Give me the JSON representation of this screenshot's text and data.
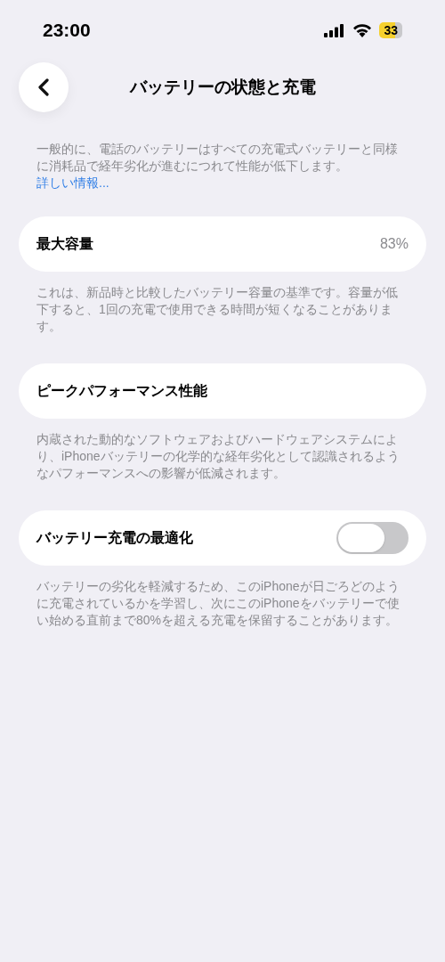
{
  "status_bar": {
    "time": "23:00",
    "battery": "33"
  },
  "header": {
    "title": "バッテリーの状態と充電"
  },
  "intro": {
    "text": "一般的に、電話のバッテリーはすべての充電式バッテリーと同様に消耗品で経年劣化が進むにつれて性能が低下します。",
    "link": "詳しい情報..."
  },
  "sections": [
    {
      "kind": "value",
      "label": "最大容量",
      "value": "83%",
      "footer": "これは、新品時と比較したバッテリー容量の基準です。容量が低下すると、1回の充電で使用できる時間が短くなることがあります。"
    },
    {
      "kind": "plain",
      "label": "ピークパフォーマンス性能",
      "footer": "内蔵された動的なソフトウェアおよびハードウェアシステムにより、iPhoneバッテリーの化学的な経年劣化として認識されるようなパフォーマンスへの影響が低減されます。"
    },
    {
      "kind": "toggle",
      "label": "バッテリー充電の最適化",
      "on": false,
      "footer": "バッテリーの劣化を軽減するため、このiPhoneが日ごろどのように充電されているかを学習し、次にこのiPhoneをバッテリーで使い始める直前まで80%を超える充電を保留することがあります。"
    }
  ]
}
